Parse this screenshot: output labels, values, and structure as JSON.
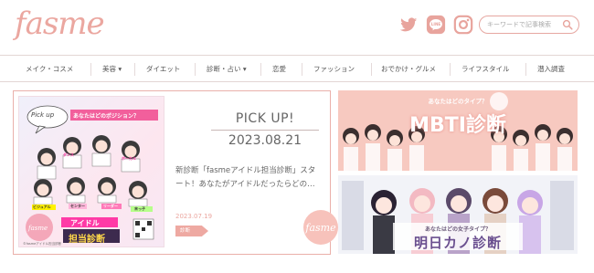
{
  "header": {
    "logo": "fasme",
    "search_placeholder": "キーワードで記事検索",
    "social": [
      "twitter-icon",
      "line-icon",
      "instagram-icon"
    ],
    "accent": "#eba7a0"
  },
  "nav": {
    "items": [
      {
        "label": "メイク・コスメ"
      },
      {
        "label": "美容 ▾"
      },
      {
        "label": "ダイエット"
      },
      {
        "label": "診断・占い ▾"
      },
      {
        "label": "恋愛"
      },
      {
        "label": "ファッション"
      },
      {
        "label": "おでかけ・グルメ"
      },
      {
        "label": "ライフスタイル"
      },
      {
        "label": "潜入調査"
      }
    ]
  },
  "pickup": {
    "heading": "PICK UP!",
    "date": "2023.08.21",
    "text": "新診断「fasmeアイドル担当診断」スタート！あなたがアイドルだったらどの…",
    "post_date": "2023.07.19",
    "tag": "診断",
    "badge": "fasme",
    "image": {
      "bubble": "Pick up",
      "ribbon": "あなたはどのポジション？",
      "title_line1": "アイドル",
      "title_line2": "担当診断",
      "roles": [
        "ビジュアル",
        "センター",
        "リーダー",
        "末っ子",
        "ダンス",
        "ボーカル"
      ],
      "brand": "fasme",
      "credit": "©fasmeアイドル担当診断"
    }
  },
  "banners": [
    {
      "subtitle": "あなたはどのタイプ？",
      "title": "MBTI診断",
      "color": "#f7c9c0"
    },
    {
      "subtitle": "あなたはどの女子タイプ？",
      "title": "明日カノ診断",
      "color": "#eef0f8"
    }
  ]
}
